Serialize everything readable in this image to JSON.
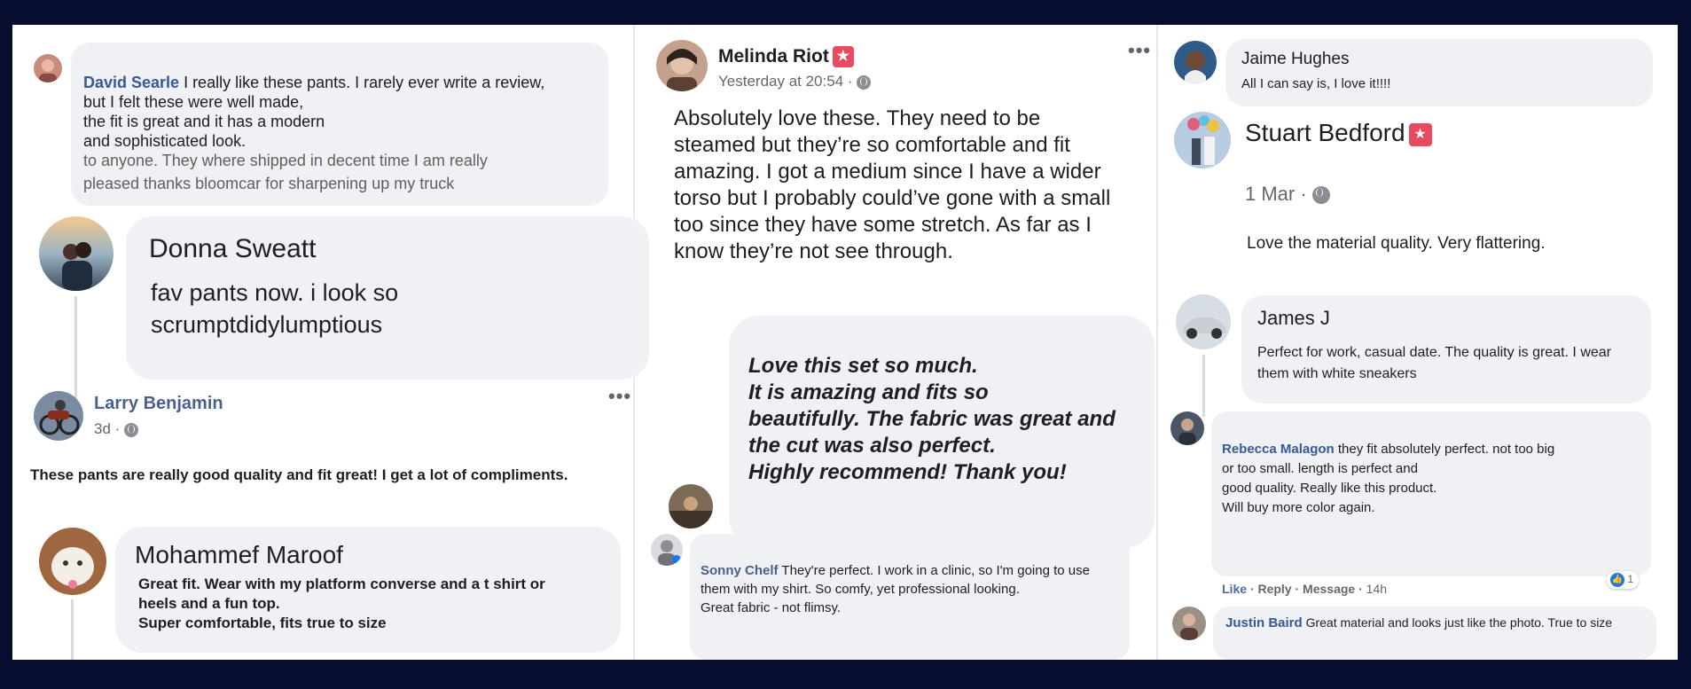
{
  "ui": {
    "colors": {
      "page_bg": "#060d2e",
      "panel_bg": "#ffffff",
      "bubble": "#eff1f4",
      "link": "#385898",
      "badge": "#e84a5f",
      "like": "#1877f2"
    },
    "icons": [
      "chevron-left-icon",
      "more-options-icon",
      "globe-icon",
      "star-badge-icon",
      "like-reaction-icon"
    ]
  },
  "comments": {
    "david": {
      "name": "David Searle",
      "text_first": " I really like these pants. I rarely ever write a review,",
      "text_rest": "but I felt these were well made,\nthe fit is great and it has a modern\nand sophisticated look.",
      "text_overlay": "to anyone.  They where shipped in decent time I am really\npleased thanks bloomcar for sharpening up my truck"
    },
    "donna": {
      "name": "Donna Sweatt",
      "text": "fav pants now. i look so\nscrumptdidylumptious"
    },
    "larry": {
      "name": "Larry Benjamin",
      "time": "3d",
      "text": "These pants are really good quality and fit great! I get a lot of compliments."
    },
    "mohammef": {
      "name": "Mohammef Maroof",
      "text": "Great fit. Wear with my platform converse and a t shirt or\nheels and a fun top.\nSuper comfortable, fits true to size"
    },
    "melinda": {
      "name": "Melinda Riot",
      "time": "Yesterday at 20:54",
      "text": "Absolutely love these. They need to be\nsteamed but they’re so comfortable and fit\namazing. I got a medium since I have a wider\ntorso but I probably could’ve gone with a small\ntoo since they have some stretch. As far as I\nknow they’re not see through."
    },
    "anon_love": {
      "text": "Love this set so much.\nIt is amazing and fits so\nbeautifully. The fabric was great and\nthe cut was also perfect.\nHighly recommend! Thank you!"
    },
    "sonny": {
      "name": "Sonny Chelf",
      "text_first": " They're perfect. I work in a clinic, so I'm going to use",
      "text_rest": "them with my shirt. So comfy, yet professional looking.\nGreat fabric - not flimsy."
    },
    "jaime": {
      "name": "Jaime Hughes",
      "text": "All I can say is, I love it!!!!"
    },
    "stuart": {
      "name": "Stuart Bedford",
      "time": "1 Mar",
      "text": "Love the material quality. Very flattering."
    },
    "james": {
      "name": "James J",
      "text": "Perfect for work, casual date. The quality is great. I wear\nthem with white sneakers"
    },
    "rebecca": {
      "name": "Rebecca Malagon",
      "text_first": " they fit absolutely perfect. not too big",
      "text_rest": "or too small. length is perfect and\ngood quality. Really like this product.\nWill buy more color again.",
      "actions": {
        "like": "Like",
        "reply": "Reply",
        "message": "Message",
        "time": "14h"
      },
      "reaction_count": "1"
    },
    "justin": {
      "name": "Justin Baird",
      "text": " Great material and looks just like the photo. True to size"
    }
  }
}
